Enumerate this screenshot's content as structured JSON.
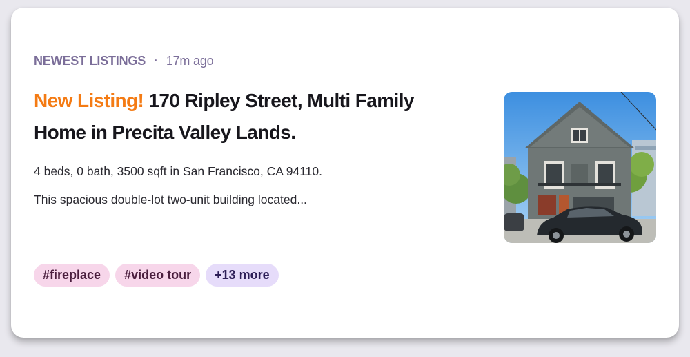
{
  "listing": {
    "section": "NEWEST LISTINGS",
    "separator": "·",
    "time_ago": "17m ago",
    "title_highlight": "New Listing!",
    "title_rest": " 170 Ripley Street, Multi Family Home in Precita Valley Lands.",
    "summary": "4 beds, 0 bath, 3500 sqft in San Francisco, CA 94110.",
    "excerpt": "This spacious double-lot two-unit building located...",
    "tags": [
      "#fireplace",
      "#video tour"
    ],
    "more_tag": "+13 more",
    "accent_color": "#f47b14",
    "meta_color": "#7b6e99",
    "tag_color": "#f7d6ea",
    "more_tag_color": "#e6dcfa"
  }
}
